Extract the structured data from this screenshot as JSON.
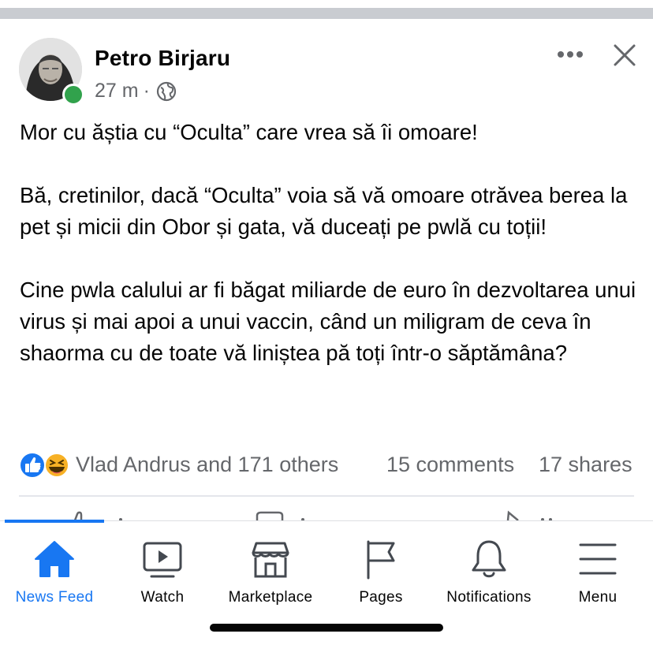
{
  "post": {
    "author": "Petro Birjaru",
    "time": "27 m",
    "separator": "·",
    "privacy_icon": "globe-icon",
    "paragraphs": [
      "Mor cu ăștia cu “Oculta” care vrea să îi omoare!",
      "Bă, cretinilor, dacă “Oculta” voia să vă omoare otrăvea berea la pet și micii din Obor și gata, vă duceați pe pwlă cu toții!",
      "Cine pwla calului ar fi băgat miliarde de euro în dezvoltarea unui virus și mai apoi a unui vaccin, când un miligram de ceva în  shaorma cu de toate vă liniștea pă toți într-o săptămâna?"
    ],
    "reactions": {
      "icons": [
        "like-icon",
        "haha-icon"
      ],
      "summary": "Vlad Andrus and 171 others"
    },
    "comments": "15 comments",
    "shares": "17 shares"
  },
  "tabbar": {
    "active": "News Feed",
    "tabs": [
      {
        "label": "News Feed",
        "icon": "home-icon"
      },
      {
        "label": "Watch",
        "icon": "watch-icon"
      },
      {
        "label": "Marketplace",
        "icon": "marketplace-icon"
      },
      {
        "label": "Pages",
        "icon": "flag-icon"
      },
      {
        "label": "Notifications",
        "icon": "bell-icon"
      },
      {
        "label": "Menu",
        "icon": "menu-icon"
      }
    ]
  },
  "colors": {
    "accent": "#1877f2",
    "secondary_text": "#65676b",
    "online": "#31a24c",
    "haha": "#f7b125"
  }
}
